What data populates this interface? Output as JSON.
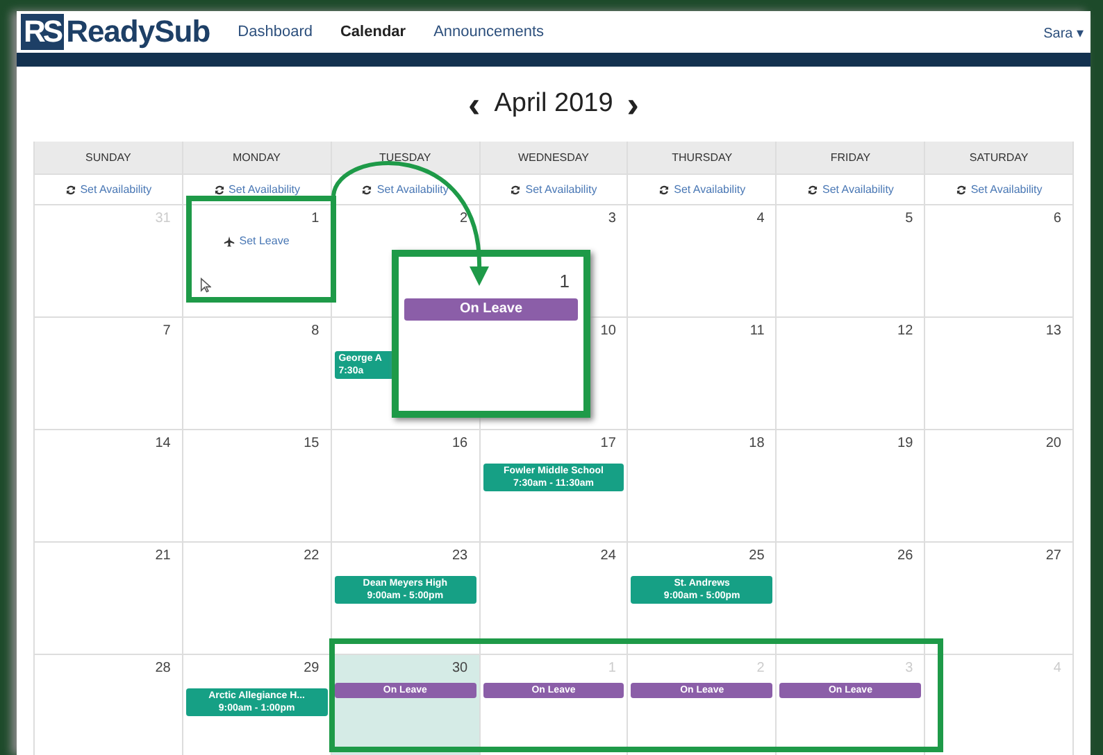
{
  "brand": {
    "logo": "RS",
    "name": "ReadySub"
  },
  "nav": [
    {
      "label": "Dashboard",
      "selected": false
    },
    {
      "label": "Calendar",
      "selected": true
    },
    {
      "label": "Announcements",
      "selected": false
    }
  ],
  "user": {
    "name": "Sara",
    "caret": "▾"
  },
  "calendar": {
    "prev": "‹",
    "title": "April 2019",
    "next": "›",
    "weekdays": [
      "SUNDAY",
      "MONDAY",
      "TUESDAY",
      "WEDNESDAY",
      "THURSDAY",
      "FRIDAY",
      "SATURDAY"
    ],
    "availability": [
      "Set Availability",
      "Set Availability",
      "Set Availability",
      "Set Availability",
      "Set Availability",
      "Set Availability",
      "Set Availability"
    ],
    "weeks": [
      [
        {
          "number": "31",
          "outside": true,
          "highlighted": false
        },
        {
          "number": "1",
          "outside": false,
          "highlighted": false,
          "action": "Set Leave"
        },
        {
          "number": "2",
          "outside": false,
          "highlighted": false
        },
        {
          "number": "3",
          "outside": false,
          "highlighted": false
        },
        {
          "number": "4",
          "outside": false,
          "highlighted": false
        },
        {
          "number": "5",
          "outside": false,
          "highlighted": false
        },
        {
          "number": "6",
          "outside": false,
          "highlighted": false
        }
      ],
      [
        {
          "number": "7",
          "outside": false,
          "highlighted": false
        },
        {
          "number": "8",
          "outside": false,
          "highlighted": false
        },
        {
          "highlighted": false,
          "events": [
            {
              "kind": "assignment",
              "title": "George A",
              "time": "7:30a"
            }
          ]
        },
        {
          "number": "10",
          "outside": false,
          "highlighted": false
        },
        {
          "number": "11",
          "outside": false,
          "highlighted": false
        },
        {
          "number": "12",
          "outside": false,
          "highlighted": false
        },
        {
          "number": "13",
          "outside": false,
          "highlighted": false
        }
      ],
      [
        {
          "number": "14",
          "outside": false,
          "highlighted": false
        },
        {
          "number": "15",
          "outside": false,
          "highlighted": false
        },
        {
          "number": "16",
          "outside": false,
          "highlighted": false
        },
        {
          "number": "17",
          "outside": false,
          "highlighted": false,
          "events": [
            {
              "kind": "assignment",
              "title": "Fowler Middle School",
              "time": "7:30am - 11:30am"
            }
          ]
        },
        {
          "number": "18",
          "outside": false,
          "highlighted": false
        },
        {
          "number": "19",
          "outside": false,
          "highlighted": false
        },
        {
          "number": "20",
          "outside": false,
          "highlighted": false
        }
      ],
      [
        {
          "number": "21",
          "outside": false,
          "highlighted": false
        },
        {
          "number": "22",
          "outside": false,
          "highlighted": false
        },
        {
          "number": "23",
          "outside": false,
          "highlighted": false,
          "events": [
            {
              "kind": "assignment",
              "title": "Dean Meyers High",
              "time": "9:00am - 5:00pm"
            }
          ]
        },
        {
          "number": "24",
          "outside": false,
          "highlighted": false
        },
        {
          "number": "25",
          "outside": false,
          "highlighted": false,
          "events": [
            {
              "kind": "assignment",
              "title": "St. Andrews",
              "time": "9:00am - 5:00pm"
            }
          ]
        },
        {
          "number": "26",
          "outside": false,
          "highlighted": false
        },
        {
          "number": "27",
          "outside": false,
          "highlighted": false
        }
      ],
      [
        {
          "number": "28",
          "outside": false,
          "highlighted": false
        },
        {
          "number": "29",
          "outside": false,
          "highlighted": false,
          "events": [
            {
              "kind": "assignment",
              "title": "Arctic Allegiance H...",
              "time": "9:00am - 1:00pm"
            }
          ]
        },
        {
          "number": "30",
          "outside": false,
          "highlighted": true,
          "events": [
            {
              "kind": "leave",
              "title": "On Leave"
            }
          ]
        },
        {
          "number": "1",
          "outside": true,
          "highlighted": false,
          "events": [
            {
              "kind": "leave",
              "title": "On Leave"
            }
          ]
        },
        {
          "number": "2",
          "outside": true,
          "highlighted": false,
          "events": [
            {
              "kind": "leave",
              "title": "On Leave"
            }
          ]
        },
        {
          "number": "3",
          "outside": true,
          "highlighted": false,
          "events": [
            {
              "kind": "leave",
              "title": "On Leave"
            }
          ]
        },
        {
          "number": "4",
          "outside": true,
          "highlighted": false
        }
      ]
    ]
  },
  "callout": {
    "number": "1",
    "event": {
      "kind": "leave",
      "title": "On Leave"
    }
  }
}
